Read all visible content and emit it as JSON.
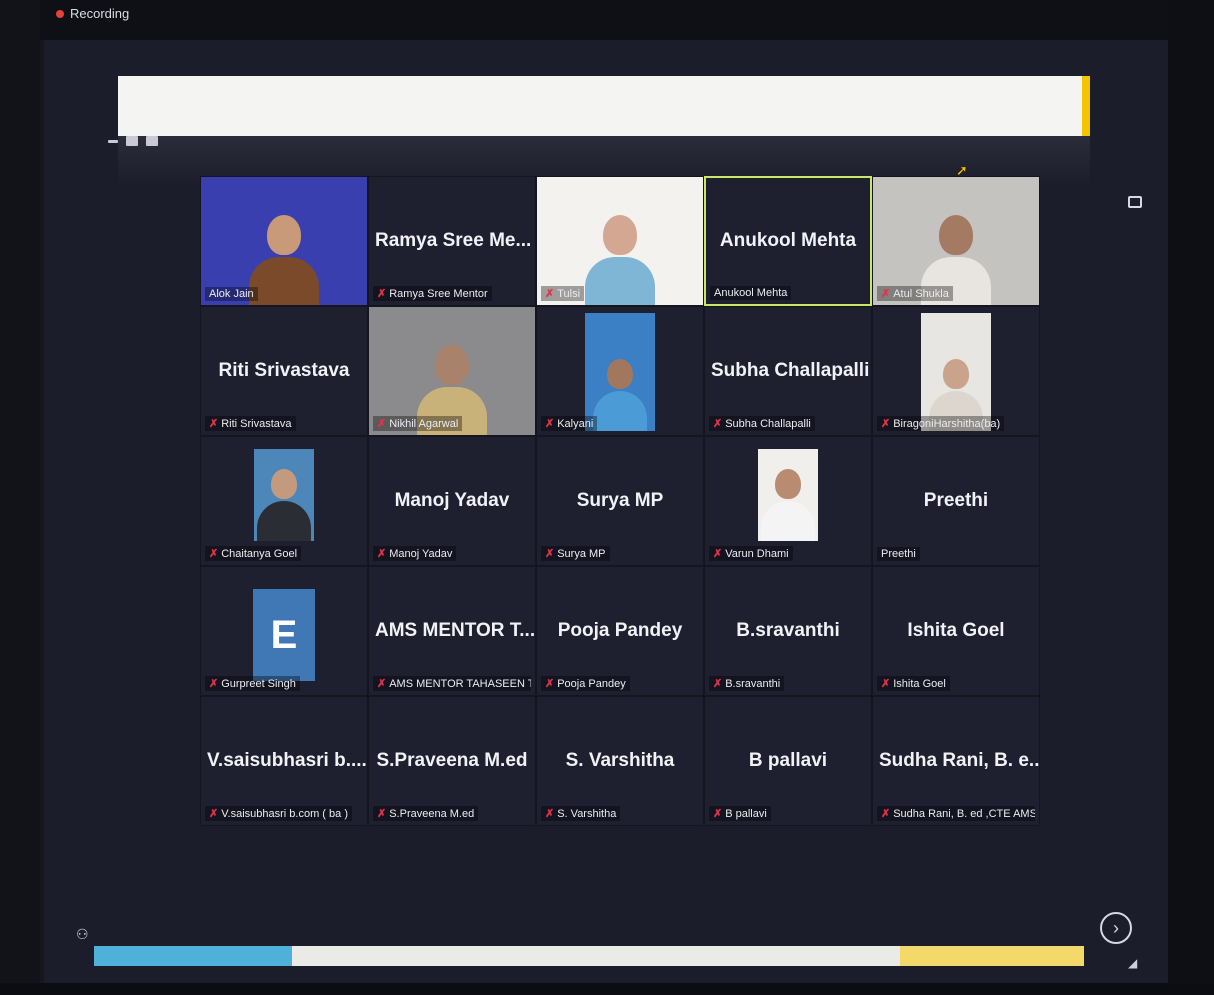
{
  "status": {
    "recording_label": "Recording"
  },
  "icons": {
    "record": "record-dot-icon",
    "mic_off": "mic-off-icon",
    "next": "chevron-right-icon",
    "view_speaker": "speaker-view-icon",
    "view_gallery": "gallery-view-icon",
    "layout": "layout-toggle-icon"
  },
  "glyphs": {
    "mic_off": "✗",
    "next": "›",
    "cursor": "➚",
    "corner_left": "⚇",
    "corner_right": "◢"
  },
  "colors": {
    "speaking_border": "#c9e86a",
    "mic_off": "#e0344a",
    "avatar_bg": "#3f78b5",
    "accent_yellow": "#f2c500"
  },
  "participants": [
    {
      "name": "Alok Jain",
      "center": "",
      "muted": false,
      "video": "alok"
    },
    {
      "name": "Ramya Sree Mentor",
      "center": "Ramya Sree Me...",
      "muted": true,
      "video": ""
    },
    {
      "name": "Tulsi",
      "center": "",
      "muted": true,
      "video": "tulsi"
    },
    {
      "name": "Anukool Mehta",
      "center": "Anukool Mehta",
      "muted": false,
      "video": "",
      "speaking": true
    },
    {
      "name": "Atul Shukla",
      "center": "",
      "muted": true,
      "video": "atul"
    },
    {
      "name": "Riti Srivastava",
      "center": "Riti Srivastava",
      "muted": true,
      "video": ""
    },
    {
      "name": "Nikhil Agarwal",
      "center": "",
      "muted": true,
      "video": "nikhil"
    },
    {
      "name": "Kalyani",
      "center": "",
      "muted": true,
      "video": "kalyani"
    },
    {
      "name": "Subha Challapalli",
      "center": "Subha Challapalli",
      "muted": true,
      "video": ""
    },
    {
      "name": "BiragoniHarshitha(ba)",
      "center": "",
      "muted": true,
      "video": "harshitha"
    },
    {
      "name": "Chaitanya Goel",
      "center": "",
      "muted": true,
      "video": "chaitanya"
    },
    {
      "name": "Manoj Yadav",
      "center": "Manoj Yadav",
      "muted": true,
      "video": ""
    },
    {
      "name": "Surya MP",
      "center": "Surya MP",
      "muted": true,
      "video": ""
    },
    {
      "name": "Varun Dhami",
      "center": "",
      "muted": true,
      "video": "varun"
    },
    {
      "name": "Preethi",
      "center": "Preethi",
      "muted": false,
      "video": ""
    },
    {
      "name": "Gurpreet Singh",
      "center": "",
      "muted": true,
      "video": "",
      "avatar": "E"
    },
    {
      "name": "AMS MENTOR TAHASEEN TABASS...",
      "center": "AMS MENTOR T...",
      "muted": true,
      "video": ""
    },
    {
      "name": "Pooja Pandey",
      "center": "Pooja Pandey",
      "muted": true,
      "video": ""
    },
    {
      "name": "B.sravanthi",
      "center": "B.sravanthi",
      "muted": true,
      "video": ""
    },
    {
      "name": "Ishita Goel",
      "center": "Ishita Goel",
      "muted": true,
      "video": ""
    },
    {
      "name": "V.saisubhasri b.com ( ba )",
      "center": "V.saisubhasri b....",
      "muted": true,
      "video": ""
    },
    {
      "name": "S.Praveena M.ed",
      "center": "S.Praveena M.ed",
      "muted": true,
      "video": ""
    },
    {
      "name": "S. Varshitha",
      "center": "S. Varshitha",
      "muted": true,
      "video": ""
    },
    {
      "name": "B pallavi",
      "center": "B pallavi",
      "muted": true,
      "video": ""
    },
    {
      "name": "Sudha Rani, B. ed ,CTE AMS",
      "center": "Sudha Rani, B. e...",
      "muted": true,
      "video": ""
    }
  ]
}
